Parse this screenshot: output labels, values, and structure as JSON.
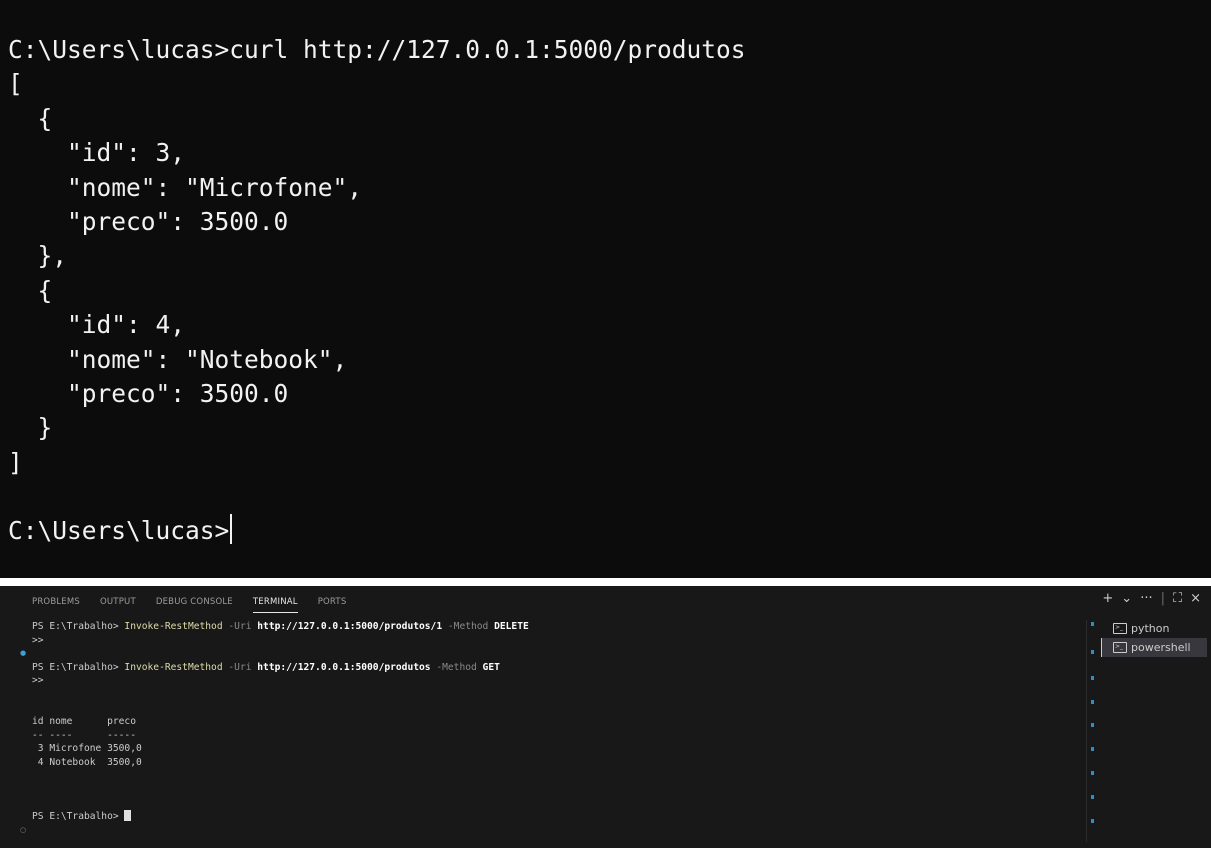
{
  "cmd_window": {
    "lines": [
      "C:\\Users\\lucas>curl http://127.0.0.1:5000/produtos",
      "[",
      "  {",
      "    \"id\": 3,",
      "    \"nome\": \"Microfone\",",
      "    \"preco\": 3500.0",
      "  },",
      "  {",
      "    \"id\": 4,",
      "    \"nome\": \"Notebook\",",
      "    \"preco\": 3500.0",
      "  }",
      "]",
      "",
      "C:\\Users\\lucas>"
    ]
  },
  "panel": {
    "tabs": [
      "PROBLEMS",
      "OUTPUT",
      "DEBUG CONSOLE",
      "TERMINAL",
      "PORTS"
    ],
    "active_tab": "TERMINAL",
    "actions": {
      "add": "+",
      "dropdown": "⌄",
      "more": "···",
      "separator": "|",
      "maximize": "⛶",
      "close": "×"
    },
    "icons": {
      "add": "plus-icon",
      "dropdown": "chevron-down-icon",
      "more": "ellipsis-icon",
      "maximize": "maximize-icon",
      "close": "close-icon",
      "terminal": "terminal-icon"
    }
  },
  "terminal": {
    "cmd1": {
      "prompt": "PS E:\\Trabalho> ",
      "cmdlet": "Invoke-RestMethod",
      "uri_param": " -Uri ",
      "uri": "http://127.0.0.1:5000/produtos/1",
      "method_param": " -Method ",
      "method": "DELETE",
      "continuation": ">>"
    },
    "cmd2": {
      "prompt": "PS E:\\Trabalho> ",
      "cmdlet": "Invoke-RestMethod",
      "uri_param": " -Uri ",
      "uri": "http://127.0.0.1:5000/produtos",
      "method_param": " -Method ",
      "method": "GET",
      "continuation": ">>"
    },
    "table": {
      "header": "id nome      preco",
      "underline": "-- ----      -----",
      "rows": [
        " 3 Microfone 3500,0",
        " 4 Notebook  3500,0"
      ]
    },
    "final_prompt": "PS E:\\Trabalho> "
  },
  "instances": [
    {
      "label": "python",
      "selected": false
    },
    {
      "label": "powershell",
      "selected": true
    }
  ],
  "colors": {
    "cmd_background": "#0c0c0c",
    "panel_background": "#181818",
    "cmdlet": "#dcdcaa",
    "decoration_blue": "#3f9fd5"
  }
}
